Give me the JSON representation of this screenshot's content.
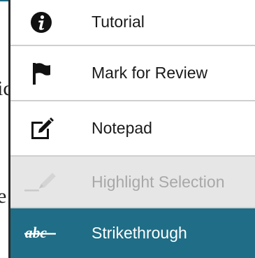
{
  "background": {
    "fragment_1": "ic",
    "fragment_2": "e"
  },
  "menu": {
    "items": [
      {
        "label": "Tutorial",
        "icon": "info-circle-icon",
        "state": "normal"
      },
      {
        "label": "Mark for Review",
        "icon": "flag-icon",
        "state": "normal"
      },
      {
        "label": "Notepad",
        "icon": "edit-note-icon",
        "state": "normal"
      },
      {
        "label": "Highlight Selection",
        "icon": "highlighter-icon",
        "state": "disabled"
      },
      {
        "label": "Strikethrough",
        "icon": "strikethrough-abc-icon",
        "state": "selected"
      }
    ]
  },
  "colors": {
    "selected_background": "#1f6d86",
    "disabled_background": "#e6e6e6",
    "disabled_text": "#a8a8a8",
    "text": "#1a1a1a",
    "divider": "#cfcfcf"
  }
}
